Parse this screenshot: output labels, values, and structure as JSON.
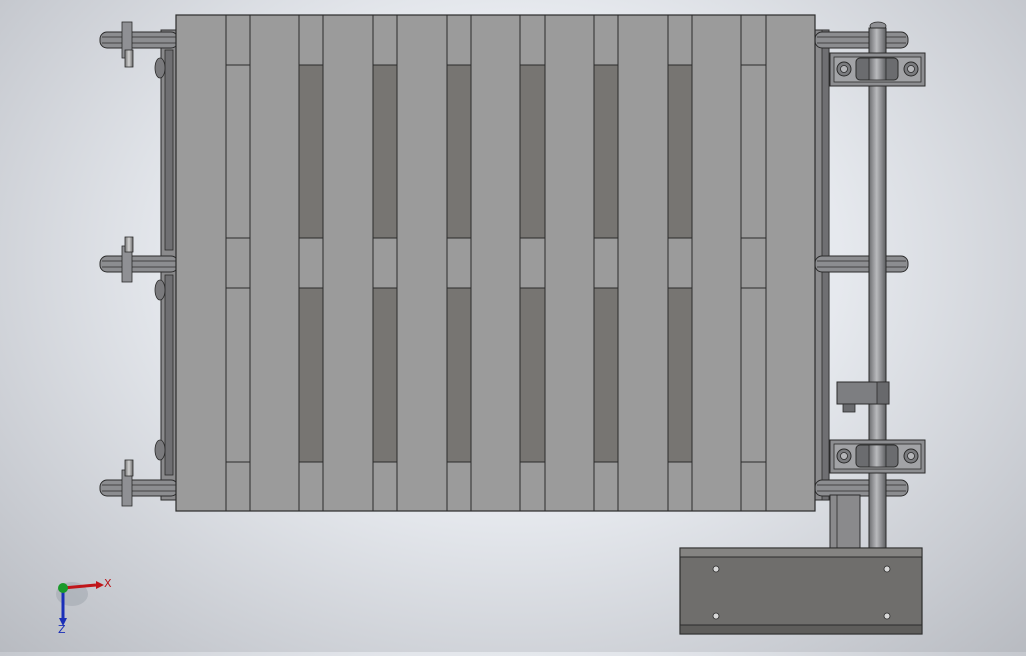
{
  "triad": {
    "x_label": "X",
    "z_label": "Z"
  },
  "colors": {
    "plate": "#9b9b9b",
    "slot": "#777572",
    "edge": "#2b2b2b",
    "metal": "#8f9094",
    "x_axis": "#c0161a",
    "y_axis": "#1a9a2a",
    "z_axis": "#1a2fb8"
  }
}
